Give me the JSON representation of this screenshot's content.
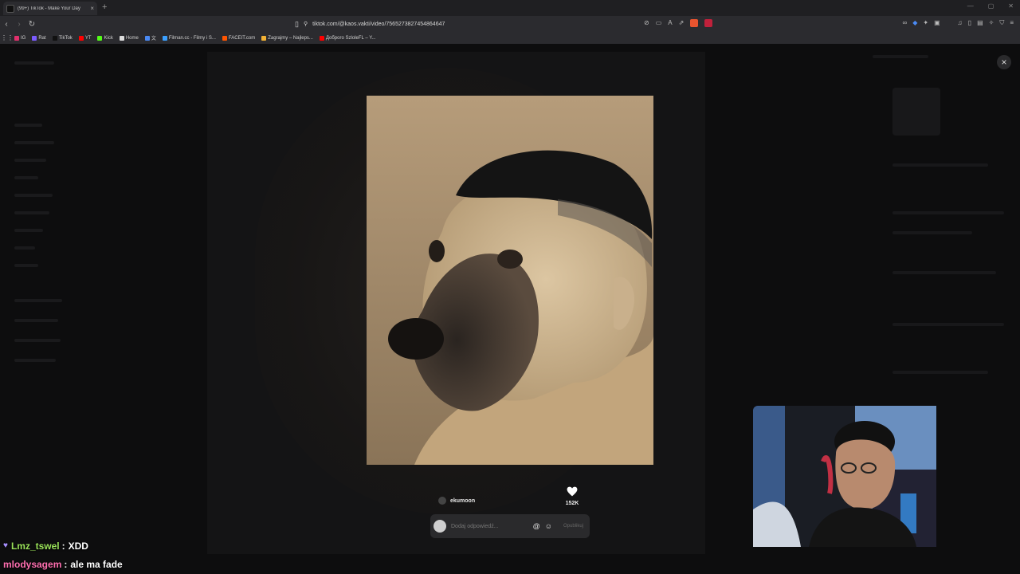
{
  "browser": {
    "tab_title": "(99+) TikTok - Make Your Day",
    "tab_close": "×",
    "new_tab": "+",
    "url": "tiktok.com/@kaos.vakti/video/7565273827454864647",
    "bookmarks": [
      {
        "label": "IG",
        "color": "#e1306c"
      },
      {
        "label": "Rat",
        "color": "#7b5cff"
      },
      {
        "label": "TikTok",
        "color": "#111111"
      },
      {
        "label": "YT",
        "color": "#ff0000"
      },
      {
        "label": "Kick",
        "color": "#53fc18"
      },
      {
        "label": "Home",
        "color": "#dddddd"
      },
      {
        "label": "文",
        "color": "#4a8af4"
      },
      {
        "label": "Filman.cc - Filmy i S...",
        "color": "#3ba0ff"
      },
      {
        "label": "FACEIT.com",
        "color": "#ff5500"
      },
      {
        "label": "Zagrajmy – Najleps...",
        "color": "#f2b134"
      },
      {
        "label": "Доброго SzloleFL – Y...",
        "color": "#ff0000"
      }
    ]
  },
  "tiktok": {
    "author": "ekumoon",
    "likes": "152K",
    "reply_placeholder": "Dodaj odpowiedź...",
    "reply_at": "@",
    "reply_emoji": "☺",
    "send_label": "Opublikuj",
    "close_icon": "×"
  },
  "chat": [
    {
      "user": "Lmz_tswel",
      "sep": ":",
      "message": "XDD",
      "user_color": "#9be35a"
    },
    {
      "user": "mlodysagem",
      "sep": ":",
      "message": "ale ma fade",
      "user_color": "#ff6fb0"
    }
  ]
}
